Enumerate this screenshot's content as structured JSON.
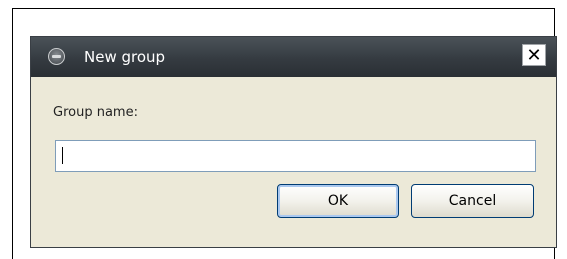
{
  "dialog": {
    "title": "New group",
    "close_label": "✕",
    "field_label": "Group name:",
    "input_value": "",
    "ok_label": "OK",
    "cancel_label": "Cancel"
  },
  "icons": {
    "app": "app-logo-icon",
    "close": "close-icon"
  },
  "colors": {
    "titlebar": "#353b41",
    "dialog_bg": "#ece9d8",
    "input_border": "#7f9db9",
    "button_border": "#003c74"
  }
}
